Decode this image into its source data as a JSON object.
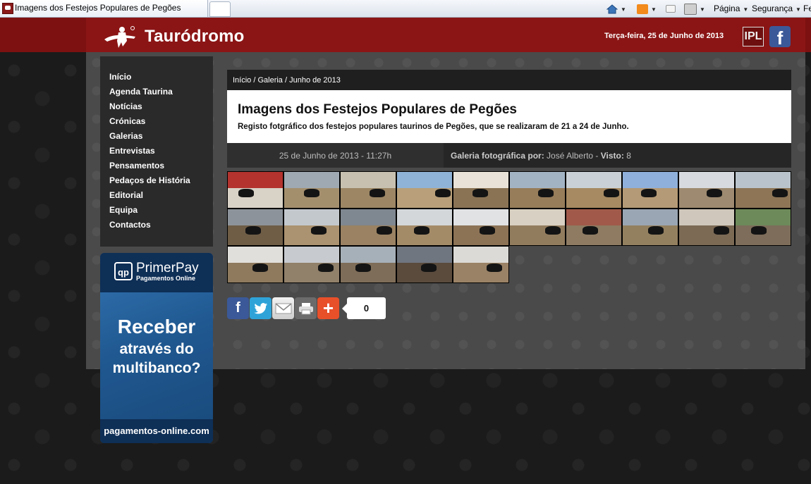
{
  "browser": {
    "tab_title": "Imagens dos Festejos Populares de Pegões",
    "commands": {
      "pagina": "Página",
      "seguranca": "Segurança",
      "cut_off": "Fe"
    }
  },
  "header": {
    "site_name": "Tauródromo",
    "date": "Terça-feira, 25 de Junho de 2013",
    "ipl_logo_text": "IPL",
    "facebook_glyph": "f"
  },
  "nav": {
    "items": [
      {
        "label": "Início"
      },
      {
        "label": "Agenda Taurina"
      },
      {
        "label": "Notícias"
      },
      {
        "label": "Crónicas"
      },
      {
        "label": "Galerias"
      },
      {
        "label": "Entrevistas"
      },
      {
        "label": "Pensamentos"
      },
      {
        "label": "Pedaços de História"
      },
      {
        "label": "Editorial"
      },
      {
        "label": "Equipa"
      },
      {
        "label": "Contactos"
      }
    ]
  },
  "ad": {
    "brand": "PrimerPay",
    "brand_sub": "Pagamentos Online",
    "brand_mark": "qp",
    "line1": "Receber",
    "line2": "através do",
    "line3": "multibanco?",
    "url": "pagamentos-online.com"
  },
  "breadcrumb": "Início / Galeria / Junho de 2013",
  "article": {
    "title": "Imagens dos Festejos Populares de Pegões",
    "subtitle": "Registo fotgráfico dos festejos populares taurinos de Pegões, que se realizaram de 21 a 24 de Junho.",
    "date": "25 de Junho de 2013 - 11:27h",
    "gallery_by_label": "Galeria fotográfica por:",
    "author": "José Alberto",
    "views_label": "Visto:",
    "views": "8"
  },
  "gallery": {
    "count": 25
  },
  "share": {
    "count": "0",
    "buttons": [
      "facebook-icon",
      "twitter-icon",
      "email-icon",
      "print-icon",
      "add-icon"
    ]
  },
  "colors": {
    "header_red": "#8b1515",
    "panel_grey": "#4a4a4a",
    "nav_bg": "#2a2a2a",
    "facebook": "#3b5998",
    "twitter": "#2fa3d8",
    "plus": "#e8502a"
  }
}
